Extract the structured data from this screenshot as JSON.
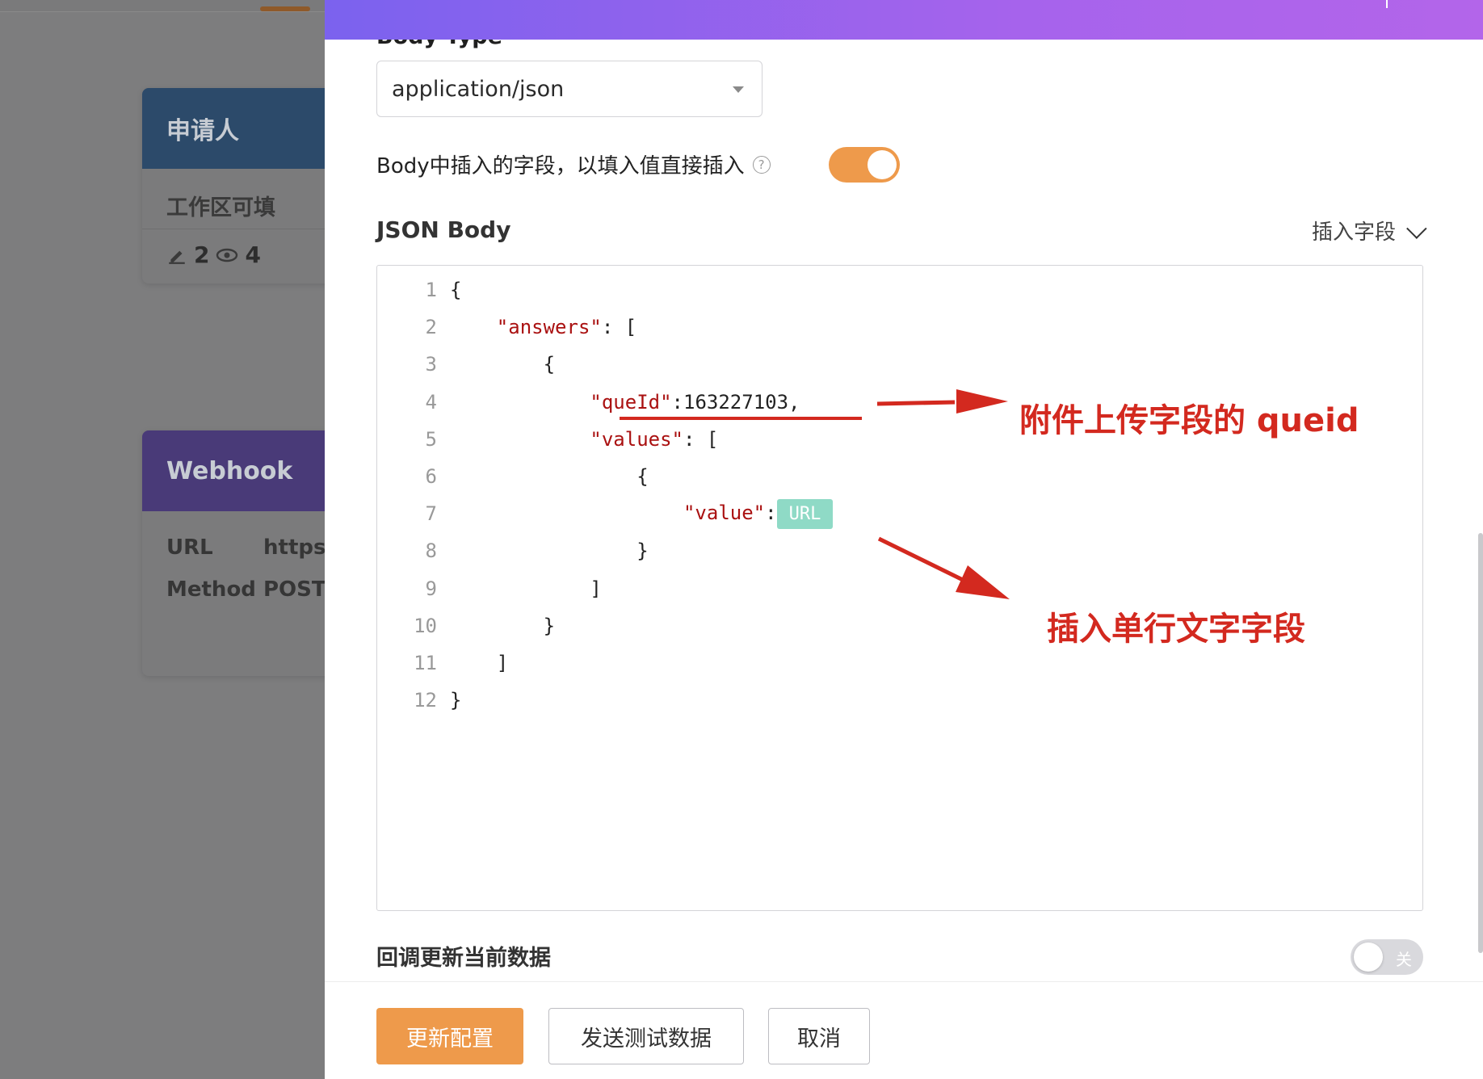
{
  "background": {
    "node_applicant": {
      "title": "申请人",
      "subtitle": "工作区可填",
      "edit_count": "2",
      "view_count": "4"
    },
    "node_webhook": {
      "title": "Webhook",
      "url_key": "URL",
      "url_value": "https:",
      "method_key": "Method",
      "method_value": "POST"
    }
  },
  "drawer": {
    "cut_label": "Body Type",
    "body_type_value": "application/json",
    "insert_direct_label": "Body中插入的字段，以填入值直接插入",
    "help_icon_text": "?",
    "insert_direct_enabled": true,
    "json_body_label": "JSON Body",
    "insert_field_label": "插入字段",
    "code_lines": [
      {
        "n": "1",
        "text": "{"
      },
      {
        "n": "2",
        "indent": "    ",
        "key": "\"answers\"",
        "rest": ": ["
      },
      {
        "n": "3",
        "text": "        {"
      },
      {
        "n": "4",
        "indent": "            ",
        "key": "\"queId\"",
        "rest": ":163227103,"
      },
      {
        "n": "5",
        "indent": "            ",
        "key": "\"values\"",
        "rest": ": ["
      },
      {
        "n": "6",
        "text": "                {"
      },
      {
        "n": "7",
        "indent": "                    ",
        "key": "\"value\"",
        "rest": ":",
        "chip": "URL"
      },
      {
        "n": "8",
        "text": "                }"
      },
      {
        "n": "9",
        "text": "            ]"
      },
      {
        "n": "10",
        "text": "        }"
      },
      {
        "n": "11",
        "text": "    ]"
      },
      {
        "n": "12",
        "text": "}"
      }
    ],
    "annotation_1": "附件上传字段的 queid",
    "annotation_2": "插入单行文字字段",
    "callback_label": "回调更新当前数据",
    "callback_toggle_text": "关",
    "callback_enabled": false,
    "footer": {
      "update_label": "更新配置",
      "send_test_label": "发送测试数据",
      "cancel_label": "取消"
    }
  },
  "colors": {
    "accent_orange": "#ee9a4b",
    "header_gradient_start": "#7b62ee",
    "header_gradient_end": "#b365ea",
    "annotation_red": "#d3291f",
    "url_chip": "#8fdac6"
  }
}
